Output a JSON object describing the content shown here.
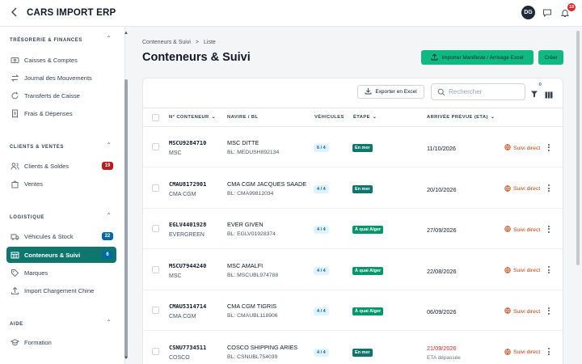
{
  "app": {
    "title": "CARS IMPORT ERP",
    "user_initials": "DG",
    "notifications_count": "19"
  },
  "sidebar": {
    "sections": [
      {
        "title": "TRÉSORERIE & FINANCES",
        "items": [
          {
            "label": "Caisses & Comptes",
            "icon": "cash-icon"
          },
          {
            "label": "Journal des Mouvements",
            "icon": "swap-icon"
          },
          {
            "label": "Transferts de Caisse",
            "icon": "refresh-icon"
          },
          {
            "label": "Frais & Dépenses",
            "icon": "receipt-icon"
          }
        ]
      },
      {
        "title": "CLIENTS & VENTES",
        "items": [
          {
            "label": "Clients & Soldes",
            "icon": "users-icon",
            "badge": "19",
            "badge_color": "#b91c1c"
          },
          {
            "label": "Ventes",
            "icon": "bag-icon"
          }
        ]
      },
      {
        "title": "LOGISTIQUE",
        "items": [
          {
            "label": "Véhicules & Stock",
            "icon": "truck-icon",
            "badge": "22",
            "badge_color": "#0369a1"
          },
          {
            "label": "Conteneurs & Suivi",
            "icon": "container-icon",
            "badge": "6",
            "badge_color": "#0369a1",
            "active": true
          },
          {
            "label": "Marques",
            "icon": "tag-icon"
          },
          {
            "label": "Import Chargement Chine",
            "icon": "upload-icon"
          }
        ]
      },
      {
        "title": "AIDE",
        "items": [
          {
            "label": "Formation",
            "icon": "graduation-icon"
          }
        ]
      }
    ]
  },
  "breadcrumb": {
    "parent": "Conteneurs & Suivi",
    "separator": ">",
    "current": "Liste"
  },
  "page": {
    "title": "Conteneurs & Suivi"
  },
  "actions": {
    "import_label": "Importer Manifeste / Arrivage Excel",
    "create_label": "Créer"
  },
  "toolbar": {
    "export_label": "Exporter en Excel",
    "search_placeholder": "Rechercher",
    "filter_count": "0"
  },
  "table": {
    "headers": {
      "container": "N° CONTENEUR",
      "vessel": "NAVIRE / BL",
      "vehicles": "VÉHICULES",
      "stage": "ÉTAPE",
      "eta": "ARRIVÉE PRÉVUE (ETA)"
    },
    "rows": [
      {
        "number": "MSCU9284710",
        "line": "MSC",
        "vessel": "MSC DITTE",
        "bl": "BL: MEDUSH892134",
        "vehicles": "6 / 4",
        "stage": "En mer",
        "stage_color": "#0f766e",
        "eta": "11/10/2026",
        "eta_note": "",
        "late": false,
        "action": "Suivi direct"
      },
      {
        "number": "CMAU8172901",
        "line": "CMA CGM",
        "vessel": "CMA CGM JACQUES SAADE",
        "bl": "BL: CMA99812034",
        "vehicles": "4 / 4",
        "stage": "En mer",
        "stage_color": "#0f766e",
        "eta": "20/10/2026",
        "eta_note": "",
        "late": false,
        "action": "Suivi direct"
      },
      {
        "number": "EGLV4401928",
        "line": "EVERGREEN",
        "vessel": "EVER GIVEN",
        "bl": "BL: EGLV01928374",
        "vehicles": "4 / 4",
        "stage": "À quai Alger",
        "stage_color": "#059669",
        "eta": "27/09/2026",
        "eta_note": "",
        "late": false,
        "action": "Suivi direct"
      },
      {
        "number": "MSCU7944240",
        "line": "MSC",
        "vessel": "MSC AMALFI",
        "bl": "BL: MSCUBL974788",
        "vehicles": "4 / 4",
        "stage": "À quai Alger",
        "stage_color": "#059669",
        "eta": "22/08/2026",
        "eta_note": "",
        "late": false,
        "action": "Suivi direct"
      },
      {
        "number": "CMAU5314714",
        "line": "CMA CGM",
        "vessel": "CMA CGM TIGRIS",
        "bl": "BL: CMAUBL118906",
        "vehicles": "4 / 4",
        "stage": "À quai Alger",
        "stage_color": "#059669",
        "eta": "06/09/2026",
        "eta_note": "",
        "late": false,
        "action": "Suivi direct"
      },
      {
        "number": "CSNU7734511",
        "line": "COSCO",
        "vessel": "COSCO SHIPPING ARIES",
        "bl": "BL: CSNUBL754039",
        "vehicles": "4 / 4",
        "stage": "En mer",
        "stage_color": "#0f766e",
        "eta": "21/09/2026",
        "eta_note": "ETA dépassée",
        "late": true,
        "action": "Suivi direct"
      }
    ]
  },
  "colors": {
    "accent": "#0f766e",
    "primary_button": "#10b981",
    "late": "#dc2626",
    "follow": "#c2410c"
  }
}
